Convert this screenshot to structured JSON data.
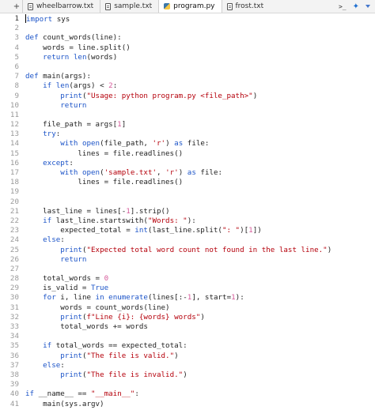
{
  "tabbar": {
    "add_label": "+",
    "tabs": [
      {
        "label": "wheelbarrow.txt",
        "icon": "document-icon",
        "active": false
      },
      {
        "label": "sample.txt",
        "icon": "document-icon",
        "active": false
      },
      {
        "label": "program.py",
        "icon": "python-icon",
        "active": true
      },
      {
        "label": "frost.txt",
        "icon": "document-icon",
        "active": false
      }
    ],
    "terminal_label": ">_",
    "extension_icon": "puzzle-icon",
    "menu_icon": "chevron-down-icon"
  },
  "colors": {
    "keyword": "#1c54c8",
    "string": "#b5000b",
    "number": "#d65a9a",
    "gutter": "#999999"
  },
  "editor": {
    "current_line": 1,
    "lines": [
      "import sys",
      "",
      "def count_words(line):",
      "    words = line.split()",
      "    return len(words)",
      "",
      "def main(args):",
      "    if len(args) < 2:",
      "        print(\"Usage: python program.py <file_path>\")",
      "        return",
      "",
      "    file_path = args[1]",
      "    try:",
      "        with open(file_path, 'r') as file:",
      "            lines = file.readlines()",
      "    except:",
      "        with open('sample.txt', 'r') as file:",
      "            lines = file.readlines()",
      "",
      "",
      "    last_line = lines[-1].strip()",
      "    if last_line.startswith(\"Words: \"):",
      "        expected_total = int(last_line.split(\": \")[1])",
      "    else:",
      "        print(\"Expected total word count not found in the last line.\")",
      "        return",
      "",
      "    total_words = 0",
      "    is_valid = True",
      "    for i, line in enumerate(lines[:-1], start=1):",
      "        words = count_words(line)",
      "        print(f\"Line {i}: {words} words\")",
      "        total_words += words",
      "",
      "    if total_words == expected_total:",
      "        print(\"The file is valid.\")",
      "    else:",
      "        print(\"The file is invalid.\")",
      "",
      "if __name__ == \"__main__\":",
      "    main(sys.argv)"
    ]
  }
}
